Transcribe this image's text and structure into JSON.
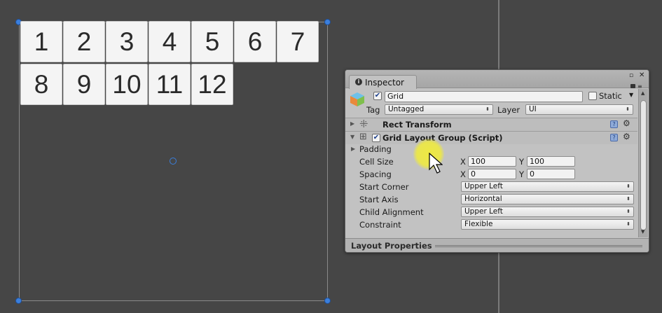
{
  "scene": {
    "cells": [
      "1",
      "2",
      "3",
      "4",
      "5",
      "6",
      "7",
      "8",
      "9",
      "10",
      "11",
      "12"
    ]
  },
  "inspector": {
    "tab_label": "Inspector",
    "tab_info_glyph": "i",
    "object_name": "Grid",
    "object_enabled": true,
    "static_label": "Static",
    "static_checked": false,
    "tag_label": "Tag",
    "tag_value": "Untagged",
    "layer_label": "Layer",
    "layer_value": "UI",
    "components": [
      {
        "name": "Rect Transform",
        "collapsed": true
      },
      {
        "name": "Grid Layout Group (Script)",
        "collapsed": false,
        "enabled": true
      }
    ],
    "grid_layout": {
      "padding_label": "Padding",
      "cell_size_label": "Cell Size",
      "cell_size_x": "100",
      "cell_size_y": "100",
      "spacing_label": "Spacing",
      "spacing_x": "0",
      "spacing_y": "0",
      "x_label": "X",
      "y_label": "Y",
      "start_corner_label": "Start Corner",
      "start_corner_value": "Upper Left",
      "start_axis_label": "Start Axis",
      "start_axis_value": "Horizontal",
      "child_alignment_label": "Child Alignment",
      "child_alignment_value": "Upper Left",
      "constraint_label": "Constraint",
      "constraint_value": "Flexible"
    },
    "layout_properties_label": "Layout Properties"
  },
  "colors": {
    "scene_bg": "#464646",
    "handle": "#3b7fdc",
    "inspector_bg": "#c2c2c2",
    "cursor_highlight": "#f0eb3c"
  }
}
